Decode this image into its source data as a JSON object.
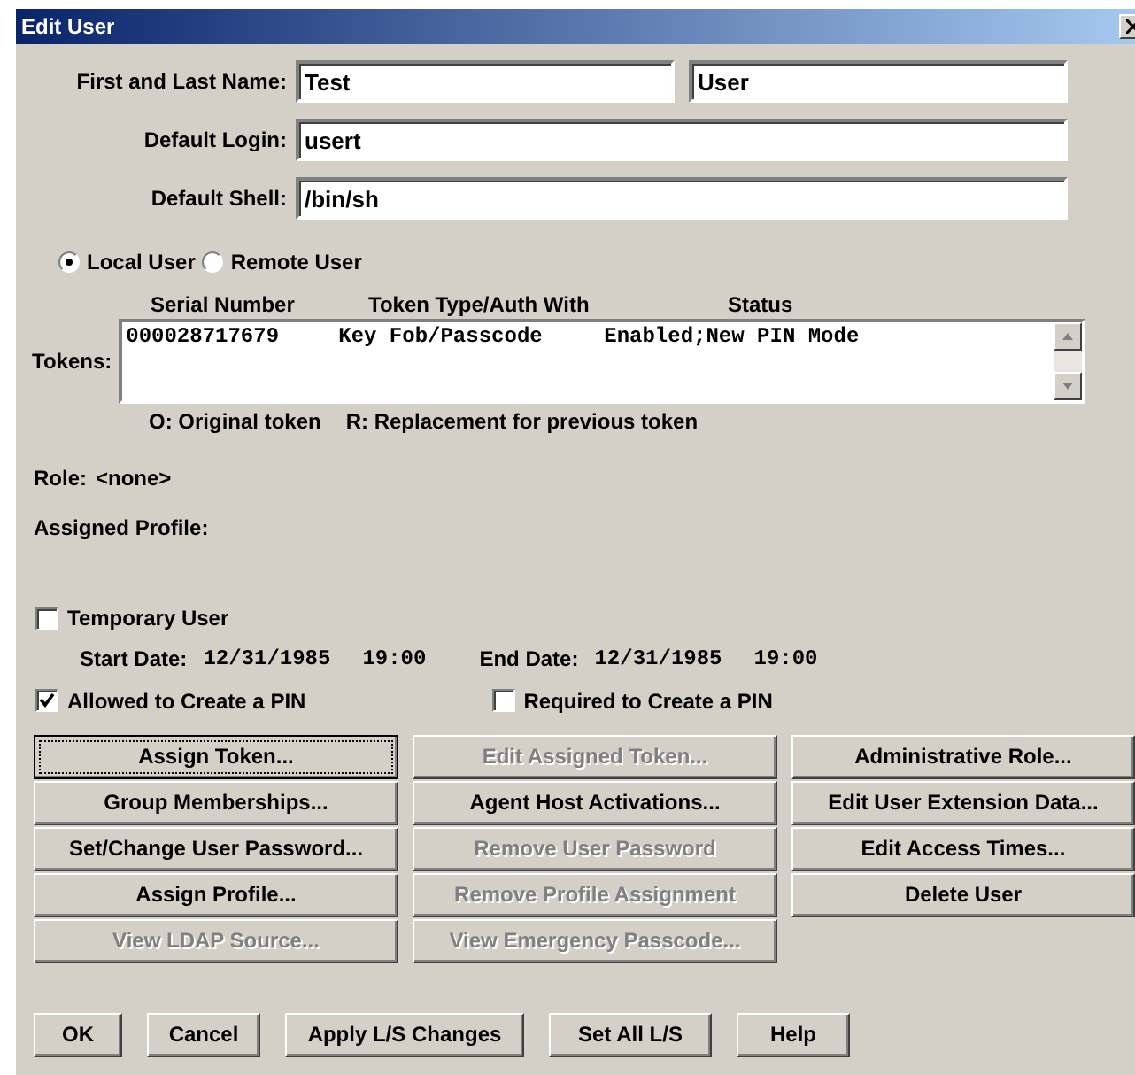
{
  "window": {
    "title": "Edit User"
  },
  "fields": [
    {
      "label": "First and Last Name:",
      "values": [
        "Test",
        "User"
      ]
    },
    {
      "label": "Default Login:",
      "values": [
        "usert"
      ]
    },
    {
      "label": "Default Shell:",
      "values": [
        "/bin/sh"
      ]
    }
  ],
  "user_type": [
    {
      "label": "Local User",
      "selected": true
    },
    {
      "label": "Remote User",
      "selected": false
    }
  ],
  "tokens": {
    "label": "Tokens:",
    "columns": [
      "Serial Number",
      "Token Type/Auth With",
      "Status"
    ],
    "rows": [
      [
        "000028717679",
        "Key Fob/Passcode",
        "Enabled;New PIN Mode"
      ]
    ],
    "legend": [
      "O: Original token",
      "R: Replacement for previous token"
    ]
  },
  "role": {
    "label": "Role:",
    "value": "<none>"
  },
  "assigned_profile": {
    "label": "Assigned Profile:"
  },
  "temporary_user": {
    "label": "Temporary User",
    "checked": false
  },
  "dates": [
    {
      "label": "Start Date:",
      "date": "12/31/1985",
      "time": "19:00"
    },
    {
      "label": "End Date:",
      "date": "12/31/1985",
      "time": "19:00"
    }
  ],
  "pin_options": [
    {
      "label": "Allowed to Create a PIN",
      "checked": true
    },
    {
      "label": "Required to Create a PIN",
      "checked": false
    }
  ],
  "action_buttons": [
    {
      "label": "Assign Token...",
      "disabled": false,
      "focused": true
    },
    {
      "label": "Edit Assigned Token...",
      "disabled": true,
      "focused": false
    },
    {
      "label": "Administrative Role...",
      "disabled": false,
      "focused": false
    },
    {
      "label": "Group Memberships...",
      "disabled": false,
      "focused": false
    },
    {
      "label": "Agent Host Activations...",
      "disabled": false,
      "focused": false
    },
    {
      "label": "Edit User Extension Data...",
      "disabled": false,
      "focused": false
    },
    {
      "label": "Set/Change User Password...",
      "disabled": false,
      "focused": false
    },
    {
      "label": "Remove User Password",
      "disabled": true,
      "focused": false
    },
    {
      "label": "Edit Access Times...",
      "disabled": false,
      "focused": false
    },
    {
      "label": "Assign Profile...",
      "disabled": false,
      "focused": false
    },
    {
      "label": "Remove Profile Assignment",
      "disabled": true,
      "focused": false
    },
    {
      "label": "Delete User",
      "disabled": false,
      "focused": false
    },
    {
      "label": "View LDAP Source...",
      "disabled": true,
      "focused": false
    },
    {
      "label": "View Emergency Passcode...",
      "disabled": true,
      "focused": false
    }
  ],
  "dialog_buttons": [
    "OK",
    "Cancel",
    "Apply L/S Changes",
    "Set All L/S",
    "Help"
  ]
}
